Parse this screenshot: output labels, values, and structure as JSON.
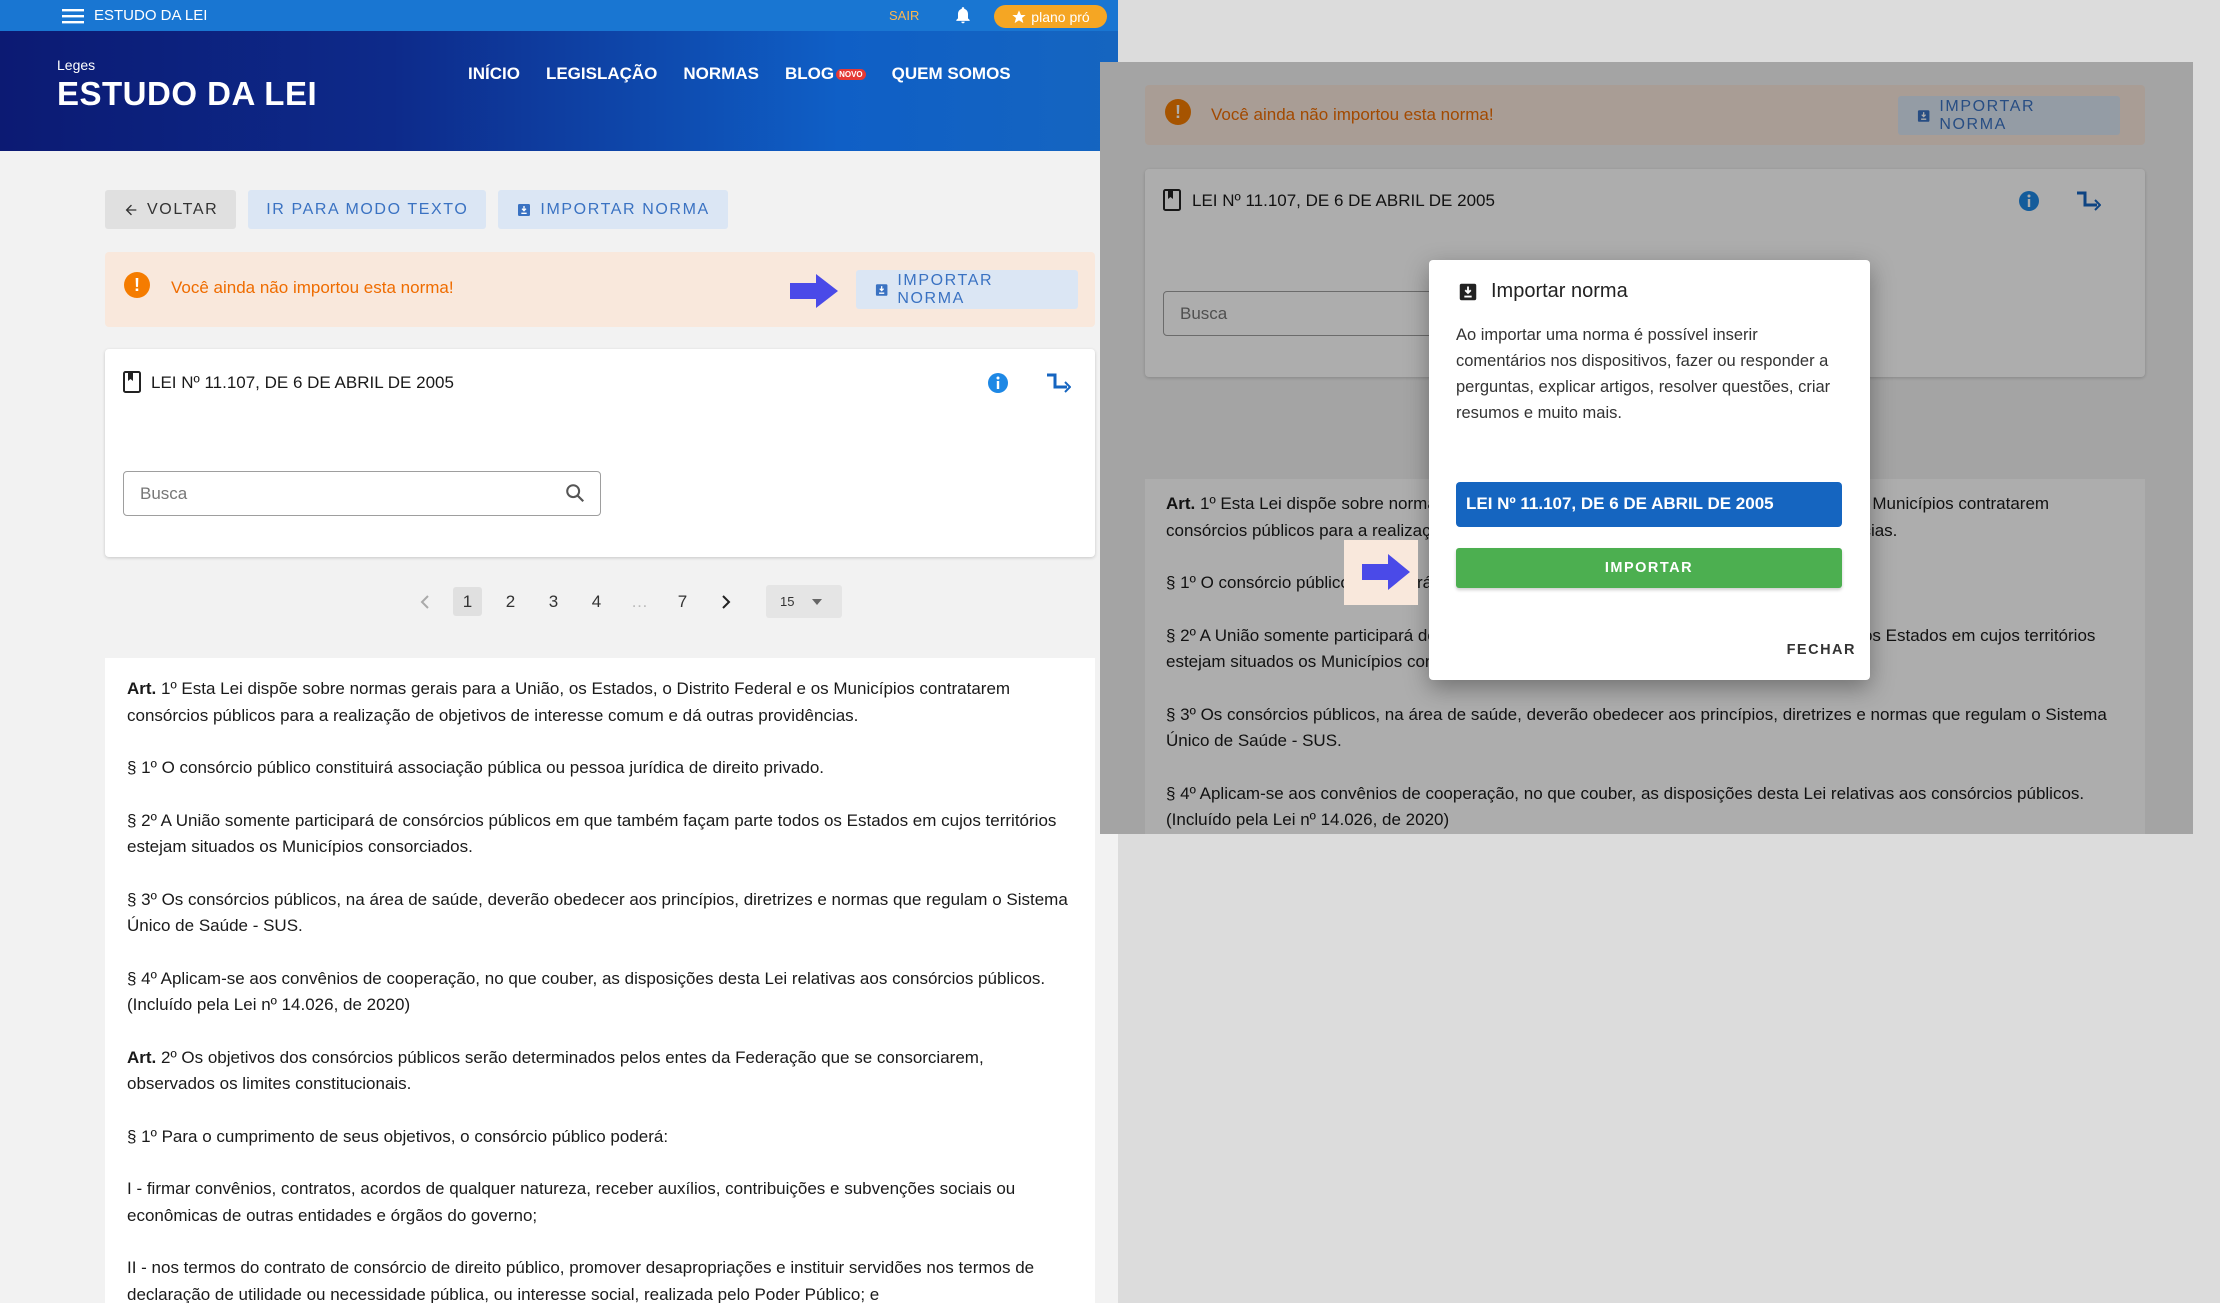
{
  "topbar": {
    "menu_label": "ESTUDO DA LEI",
    "logout": "SAIR",
    "pro_label": "plano pró"
  },
  "header": {
    "brand_small": "Leges",
    "brand": "ESTUDO DA LEI",
    "nav": [
      "INÍCIO",
      "LEGISLAÇÃO",
      "NORMAS",
      "BLOG",
      "QUEM SOMOS"
    ],
    "nav_badge": "NOVO"
  },
  "actions": {
    "back": "VOLTAR",
    "text_mode": "IR PARA MODO TEXTO",
    "import": "IMPORTAR NORMA"
  },
  "alert": {
    "message": "Você ainda não importou esta norma!",
    "button": "IMPORTAR NORMA"
  },
  "law": {
    "title": "LEI Nº 11.107, DE 6 DE ABRIL DE 2005",
    "search_placeholder": "Busca"
  },
  "pagination": {
    "pages": [
      "1",
      "2",
      "3",
      "4",
      "7"
    ],
    "current": "1",
    "ellipsis": "…",
    "page_size": "15"
  },
  "articles": [
    {
      "bold": "Art.",
      "text": " 1º Esta Lei dispõe sobre normas gerais para a União, os Estados, o Distrito Federal e os Municípios contratarem consórcios públicos para a realização de objetivos de interesse comum e dá outras providências."
    },
    {
      "bold": "",
      "text": "§ 1º O consórcio público constituirá associação pública ou pessoa jurídica de direito privado."
    },
    {
      "bold": "",
      "text": "§ 2º A União somente participará de consórcios públicos em que também façam parte todos os Estados em cujos territórios estejam situados os Municípios consorciados."
    },
    {
      "bold": "",
      "text": "§ 3º Os consórcios públicos, na área de saúde, deverão obedecer aos princípios, diretrizes e normas que regulam o Sistema Único de Saúde - SUS."
    },
    {
      "bold": "",
      "text": "§ 4º Aplicam-se aos convênios de cooperação, no que couber, as disposições desta Lei relativas aos consórcios públicos. (Incluído pela Lei nº 14.026, de 2020)"
    },
    {
      "bold": "Art.",
      "text": " 2º Os objetivos dos consórcios públicos serão determinados pelos entes da Federação que se consorciarem, observados os limites constitucionais."
    },
    {
      "bold": "",
      "text": "§ 1º Para o cumprimento de seus objetivos, o consórcio público poderá:"
    },
    {
      "bold": "",
      "text": "I - firmar convênios, contratos, acordos de qualquer natureza, receber auxílios, contribuições e subvenções sociais ou econômicas de outras entidades e órgãos do governo;"
    },
    {
      "bold": "",
      "text": "II - nos termos do contrato de consórcio de direito público, promover desapropriações e instituir servidões nos termos de declaração de utilidade ou necessidade pública, ou interesse social, realizada pelo Poder Público; e"
    }
  ],
  "dialog": {
    "title": "Importar norma",
    "body": "Ao importar uma norma é possível inserir comentários nos dispositivos, fazer ou responder a perguntas, explicar artigos, resolver questões, criar resumos e muito mais.",
    "law_name": "LEI Nº 11.107, DE 6 DE ABRIL DE 2005",
    "confirm": "IMPORTAR",
    "close": "FECHAR"
  },
  "colors": {
    "primary": "#1976d2",
    "warning": "#f57c00",
    "alert_bg": "#f9e8dc",
    "success": "#4caf50",
    "arrow": "#4a4ae8"
  }
}
